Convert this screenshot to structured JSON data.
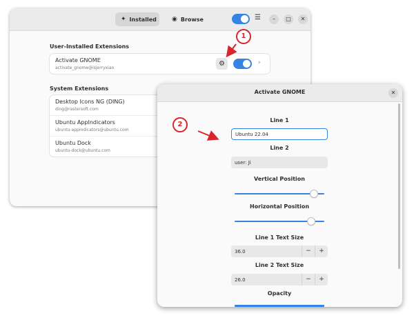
{
  "header": {
    "tabs": [
      {
        "label": "Installed",
        "icon": "puzzle-icon",
        "active": true
      },
      {
        "label": "Browse",
        "icon": "globe-icon",
        "active": false
      }
    ],
    "main_toggle_on": true
  },
  "user_section": {
    "title": "User-Installed Extensions",
    "items": [
      {
        "name": "Activate GNOME",
        "id": "activate_gnome@isjerryxiao",
        "enabled": true
      }
    ]
  },
  "system_section": {
    "title": "System Extensions",
    "items": [
      {
        "name": "Desktop Icons NG (DING)",
        "id": "ding@rastersoft.com"
      },
      {
        "name": "Ubuntu AppIndicators",
        "id": "ubuntu-appindicators@ubuntu.com"
      },
      {
        "name": "Ubuntu Dock",
        "id": "ubuntu-dock@ubuntu.com"
      }
    ]
  },
  "dialog": {
    "title": "Activate GNOME",
    "line1_label": "Line 1",
    "line1_value": "Ubuntu 22.04",
    "line2_label": "Line 2",
    "line2_value": "user: Ji",
    "vpos_label": "Vertical Position",
    "vpos_level": 0.92,
    "hpos_label": "Horizontal Position",
    "hpos_level": 0.88,
    "line1_size_label": "Line 1 Text Size",
    "line1_size_value": "36.0",
    "line2_size_label": "Line 2 Text Size",
    "line2_size_value": "26.0",
    "opacity_label": "Opacity",
    "minus": "−",
    "plus": "+"
  },
  "annotations": {
    "step1": "1",
    "step2": "2",
    "color": "#d9232d"
  },
  "colors": {
    "accent": "#3584e4"
  }
}
